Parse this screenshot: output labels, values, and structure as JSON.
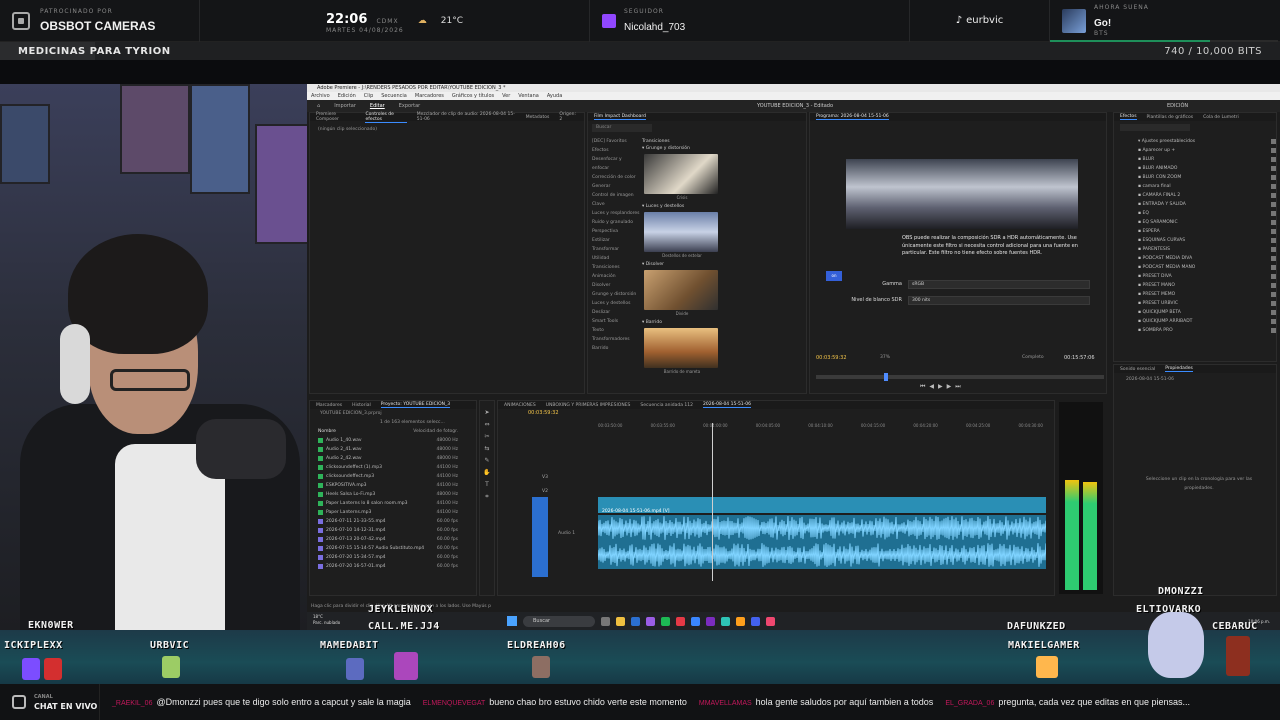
{
  "topbar": {
    "sponsor_label": "PATROCINADO POR",
    "sponsor_name": "OBSBOT CAMERAS",
    "time": "22:06",
    "time_tz": "CDMX",
    "date": "MARTES 04/08/2026",
    "temperature": "21°C",
    "follower_label": "SEGUIDOR",
    "follower_name": "Nicolahd_703",
    "tiktok_handle": "eurbvic",
    "now_playing_label": "AHORA SUENA",
    "now_playing_title": "Go!",
    "now_playing_artist": "BTS",
    "now_playing_progress": 0.7
  },
  "goal": {
    "title": "MEDICINAS PARA TYRION",
    "count": "740 / 10,000 BITS",
    "progress": 0.074
  },
  "premiere": {
    "title": "Adobe Premiere - J:\\RENDERS PESADOS POR EDITAR\\YOUTUBE EDICION_3 *",
    "menu": [
      "Archivo",
      "Edición",
      "Clip",
      "Secuencia",
      "Marcadores",
      "Gráficos y títulos",
      "Ver",
      "Ventana",
      "Ayuda"
    ],
    "workspace_tabs": [
      "Importar",
      "Editar",
      "Exportar"
    ],
    "active_workspace": "Editar",
    "center_title": "YOUTUBE EDICION_3 - Editado",
    "right_label": "EDICIÓN",
    "source_tabs": [
      "Premiere Composer",
      "Controles de efectos",
      "Mezclador de clip de audio: 2026-08-04 15-51-06",
      "Metadatos",
      "Orígen: 2"
    ],
    "no_clip": "(ningún clip seleccionado)",
    "film_panel": "Film Impact Dashboard",
    "search_placeholder": "Buscar",
    "categories_left": [
      "[DEC] Favoritos",
      "Efectos",
      "Desenfocar y enfocar",
      "Corrección de color",
      "Generar",
      "Control de imagen",
      "Clave",
      "Luces y resplandores",
      "Ruido y granulado",
      "Perspectiva",
      "Estilizar",
      "Transformar",
      "Utilidad",
      "Transiciones",
      "Animación",
      "Disolver",
      "Grunge y distorsión",
      "Luces y destellos",
      "Deslizar",
      "Smart Tools",
      "Texto",
      "Transformadores",
      "Barrido"
    ],
    "thumb_groups": [
      {
        "head": "Transiciones",
        "sub": "Grunge y distorsión",
        "label": "Crisis"
      },
      {
        "head": "",
        "sub": "Luces y destellos",
        "label": "Destellos de estelar"
      },
      {
        "head": "",
        "sub": "Disolver",
        "label": "Divide"
      },
      {
        "head": "",
        "sub": "Barrido",
        "label": "Barrido de mareta"
      }
    ],
    "program_label": "Programa: 2026-08-04 15-51-06",
    "hdr_text": "OBS puede realizar la composición SDR a HDR automáticamente. Use únicamente este filtro si necesita control adicional para una fuente en particular. Este filtro no tiene efecto sobre fuentes HDR.",
    "gamma_label": "Gamma",
    "gamma_value": "sRGB",
    "white_label": "Nivel de blanco SDR",
    "white_value": "300 nits",
    "chip_label": "on",
    "timecode_in": "00:03:59:32",
    "timecode_out": "00:15:57:06",
    "fit_label": "Completo",
    "zoom_label": "37%",
    "effects_tabs": [
      "Efectos",
      "Plantillas de gráficos",
      "Cola de Lumetri"
    ],
    "effects_items": [
      "Ajustes preestablecidos",
      "Aparecer up +",
      "BLUR",
      "BLUR ANIMADO",
      "BLUR CON ZOOM",
      "camara final",
      "CAMARA FINAL 2",
      "ENTRADA Y SALIDA",
      "EQ",
      "EQ SARAMONIC",
      "ESPERA",
      "ESQUINAS CURVAS",
      "PARENTESIS",
      "PODCAST MEDIA DIVA",
      "PODCAST MEDIA MANO",
      "PRESET DIVA",
      "PRESET MANO",
      "PRESET MEMO",
      "PRESET URBVIC",
      "QUICKJUMP BETA",
      "QUICKJUMP ARRIBADT",
      "SOMBRA PRO"
    ],
    "props_tabs": [
      "Sonido esencial",
      "Propiedades"
    ],
    "props_file": "2026-08-04 15-51-06",
    "props_empty": "Seleccione un clip en la cronología para ver las propiedades.",
    "project_tabs": [
      "Marcadores",
      "Historial",
      "Proyecto: YOUTUBE EDICION_3"
    ],
    "project_name": "YOUTUBE EDICION_3.prproj",
    "project_count": "1 de 163 elementos selecc...",
    "project_cols": [
      "Nombre",
      "Velocidad de fotogr."
    ],
    "project_rows": [
      {
        "name": "Audio 1_40.wav",
        "fps": "48000 Hz",
        "type": "audio"
      },
      {
        "name": "Audio 2_41.wav",
        "fps": "48000 Hz",
        "type": "audio"
      },
      {
        "name": "Audio 2_42.wav",
        "fps": "48000 Hz",
        "type": "audio"
      },
      {
        "name": "clicksoundeffect (1).mp3",
        "fps": "44100 Hz",
        "type": "audio"
      },
      {
        "name": "clicksoundeffect.mp3",
        "fps": "44100 Hz",
        "type": "audio"
      },
      {
        "name": "ESKPOSITIVA.mp3",
        "fps": "44100 Hz",
        "type": "audio"
      },
      {
        "name": "Heels Salsa Lo-Fi.mp3",
        "fps": "48000 Hz",
        "type": "audio"
      },
      {
        "name": "Paper Lanterns lo 8 salon room.mp3",
        "fps": "44100 Hz",
        "type": "audio"
      },
      {
        "name": "Paper Lanterns.mp3",
        "fps": "44100 Hz",
        "type": "audio"
      },
      {
        "name": "2026-07-11 21-33-55.mp4",
        "fps": "60.00 fps",
        "type": "video"
      },
      {
        "name": "2026-07-10 14-12-31.mp4",
        "fps": "60.00 fps",
        "type": "video"
      },
      {
        "name": "2026-07-13 20-07-42.mp4",
        "fps": "60.00 fps",
        "type": "video"
      },
      {
        "name": "2026-07-15 15-14-57 Audio Substituto.mp4",
        "fps": "60.00 fps",
        "type": "video"
      },
      {
        "name": "2026-07-20 15-34-57.mp4",
        "fps": "60.00 fps",
        "type": "video"
      },
      {
        "name": "2026-07-20 16-57-01.mp4",
        "fps": "60.00 fps",
        "type": "video"
      }
    ],
    "timeline_tabs": [
      "ANIMACIONES",
      "UNBOXING Y PRIMERAS IMPRESIONES",
      "Secuencia anidada 112",
      "2026-08-04 15-51-06"
    ],
    "timeline_tc": "00:03:59:32",
    "ruler": [
      "00:03:50:00",
      "00:03:55:00",
      "00:04:00:00",
      "00:04:05:00",
      "00:04:10:00",
      "00:04:15:00",
      "00:04:20:00",
      "00:04:25:00",
      "00:04:30:00"
    ],
    "clip_label": "2026-08-04 15-51-06.mp4 [V]",
    "track_labels": [
      "V3",
      "V2",
      "V1",
      "A1",
      "A2"
    ],
    "audio_label": "Audio 1",
    "status_hint": "Haga clic para dividir el clip. Use Alt para dirigirse solo a los lados. Use Mayús para dividir todas las pistas.",
    "taskbar_search": "Buscar",
    "taskbar_temp": "18°C",
    "taskbar_weather": "Parc. nublado",
    "taskbar_clock": "10:06 p.m."
  },
  "stream_bottom": {
    "names": [
      {
        "name": "EKN0WER"
      },
      {
        "name": "JEYKLENNOX"
      },
      {
        "name": "CALL.ME.JJ4"
      },
      {
        "name": "DMONZZI"
      },
      {
        "name": "ELTIOVARKO"
      },
      {
        "name": "DAFUNKZED"
      },
      {
        "name": "ICKIPLEXX"
      },
      {
        "name": "URBVIC"
      },
      {
        "name": "MAMEDABIT"
      },
      {
        "name": "ELDREAH06"
      },
      {
        "name": "MAKIELGAMER"
      },
      {
        "name": "CEBARUC"
      }
    ]
  },
  "chat": {
    "label_small": "CANAL",
    "label": "CHAT EN VIVO",
    "messages": [
      {
        "user": "_RAEKIL_06",
        "text": "@Dmonzzi pues que te digo solo entro a capcut y sale la magia"
      },
      {
        "user": "ELMENQUEVEGAT",
        "text": "bueno chao bro estuvo chido verte este momento"
      },
      {
        "user": "MMAVELLAMAS",
        "text": "hola gente saludos por aquí tambien a todos"
      },
      {
        "user": "EL_GRADA_06",
        "text": "pregunta, cada vez que editas en que piensas..."
      }
    ]
  }
}
